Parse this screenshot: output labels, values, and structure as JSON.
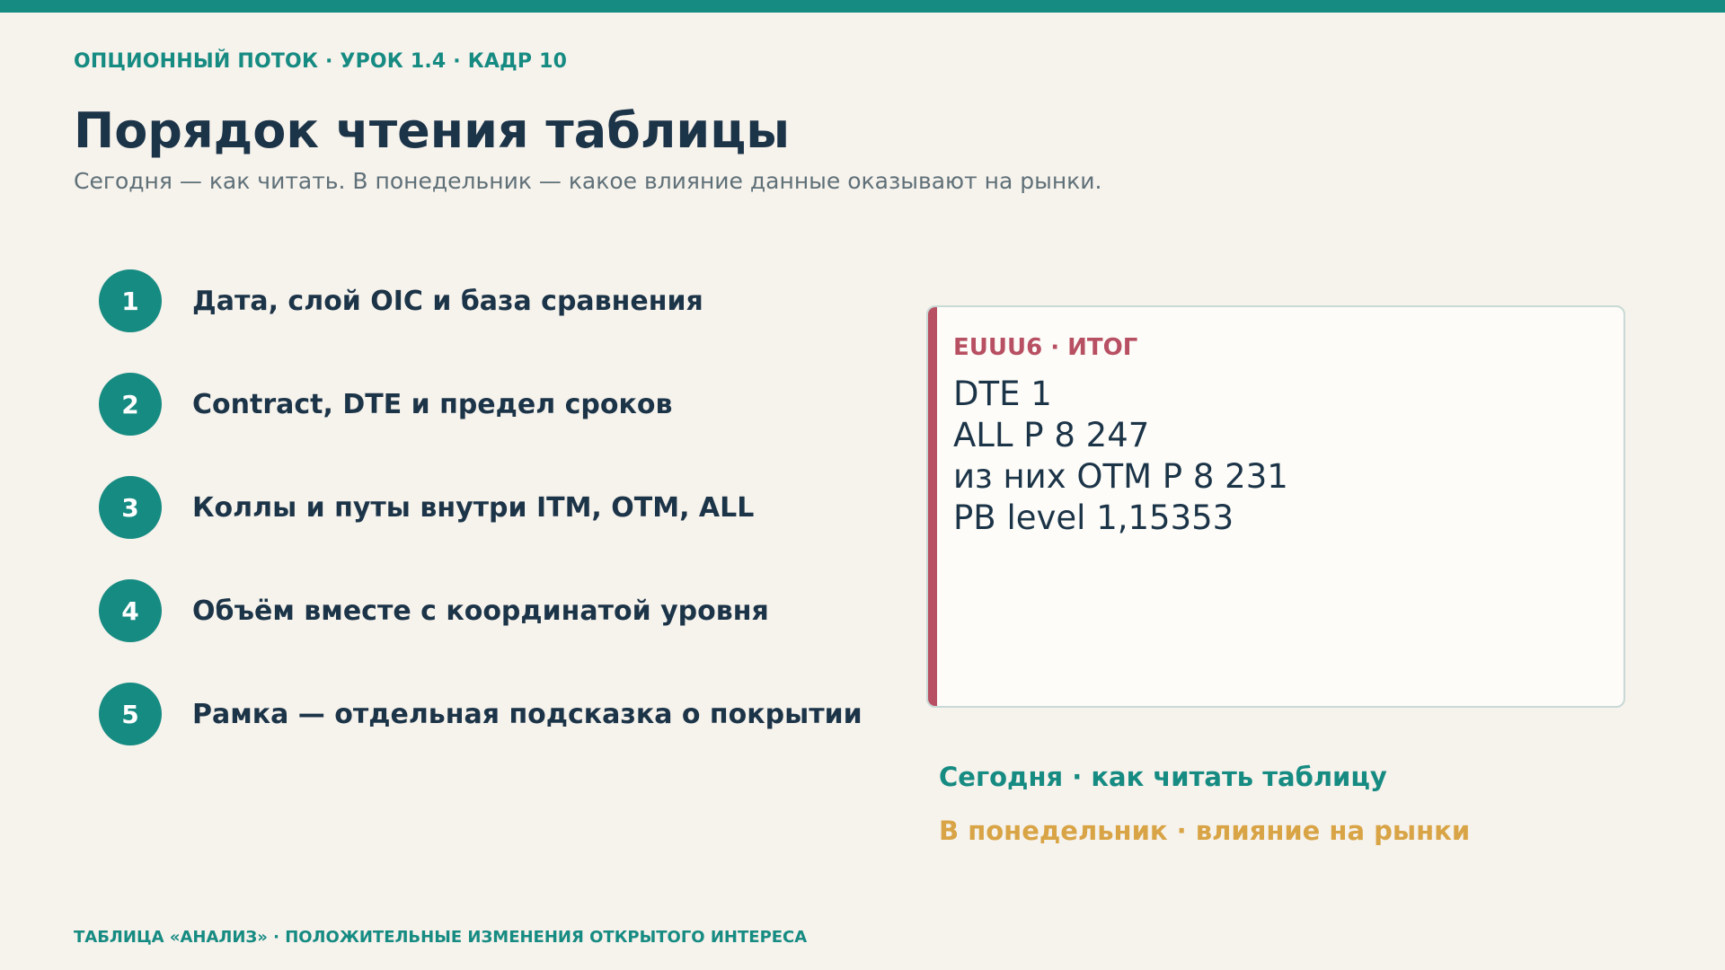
{
  "header": {
    "kicker": "ОПЦИОННЫЙ ПОТОК · УРОК 1.4 · КАДР 10",
    "title": "Порядок чтения таблицы",
    "subtitle": "Сегодня — как читать. В понедельник — какое влияние данные оказывают на рынки."
  },
  "steps": [
    {
      "number": "1",
      "label": "Дата, слой OIC и база сравнения"
    },
    {
      "number": "2",
      "label": "Contract, DTE и предел сроков"
    },
    {
      "number": "3",
      "label": "Коллы и путы внутри ITM, OTM, ALL"
    },
    {
      "number": "4",
      "label": "Объём вместе с координатой уровня"
    },
    {
      "number": "5",
      "label": "Рамка — отдельная подсказка о покрытии"
    }
  ],
  "card": {
    "tag": "EUUU6 · ИТОГ",
    "lines": [
      "DTE 1",
      "ALL P 8 247",
      "из них OTM P 8 231",
      "PB level 1,15353"
    ]
  },
  "legend": {
    "today": "Сегодня · как читать таблицу",
    "monday": "В понедельник · влияние на рынки"
  },
  "footer": "ТАБЛИЦА «АНАЛИЗ» · ПОЛОЖИТЕЛЬНЫЕ ИЗМЕНЕНИЯ ОТКРЫТОГО ИНТЕРЕСА",
  "colors": {
    "accent": "#168b82",
    "card_accent": "#b85063",
    "monday": "#d8a445",
    "background": "#f6f2ec",
    "text": "#1c3448"
  }
}
